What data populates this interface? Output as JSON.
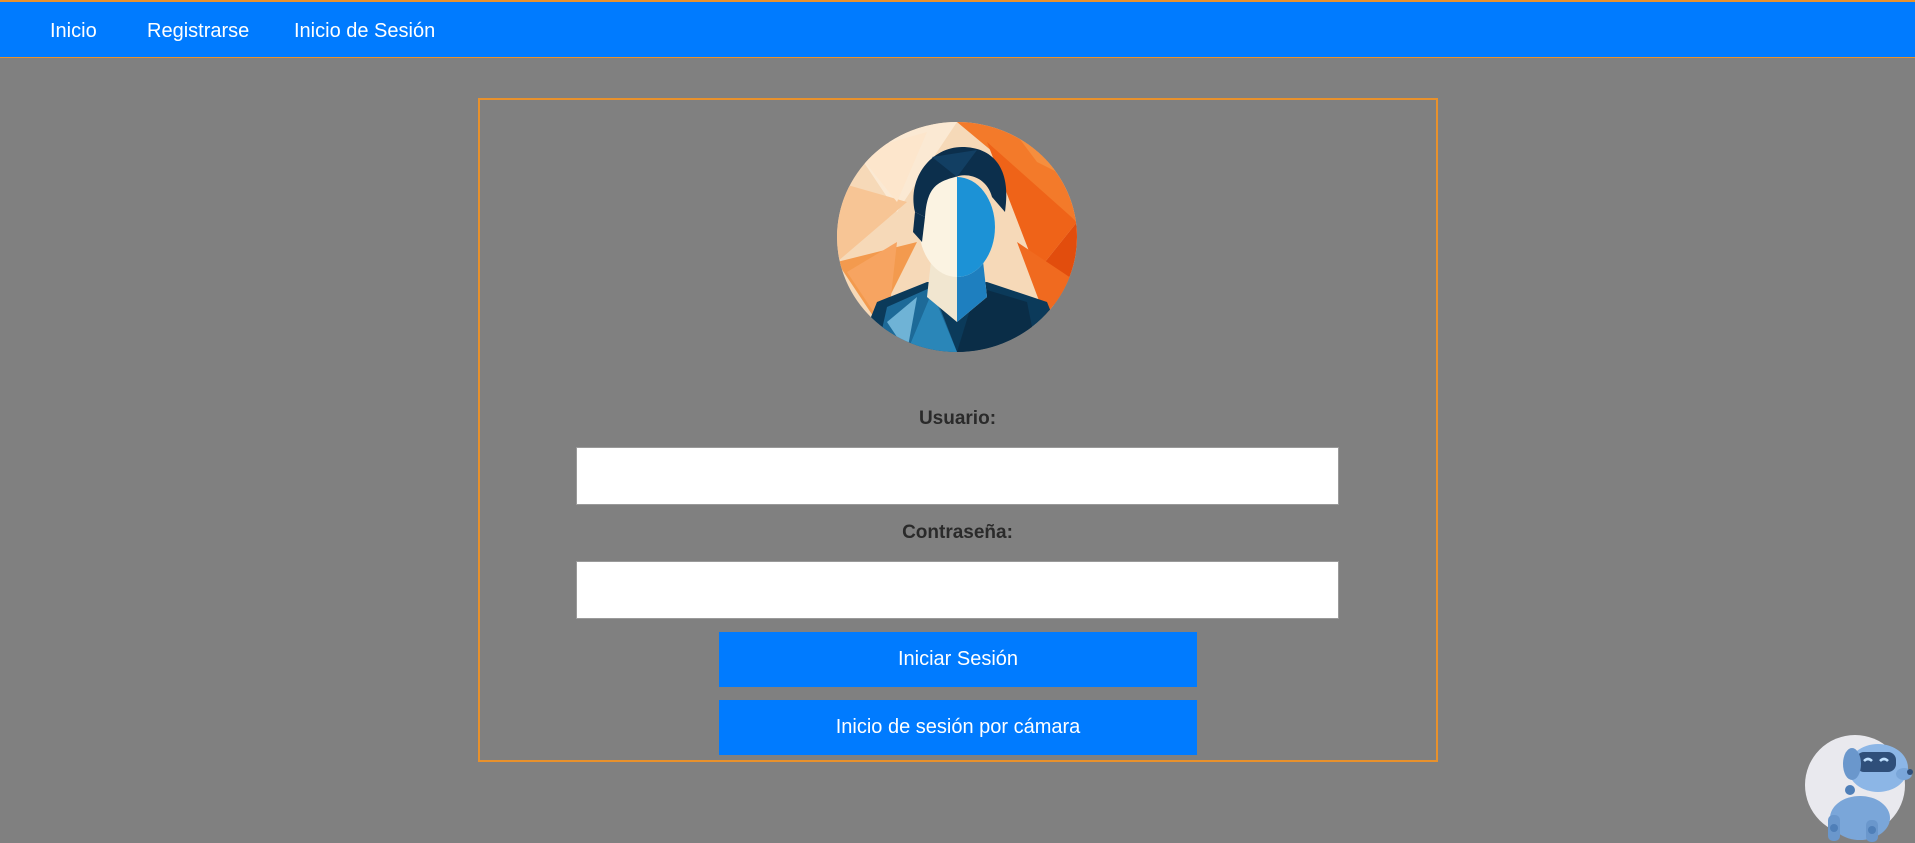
{
  "navbar": {
    "items": [
      {
        "label": "Inicio"
      },
      {
        "label": "Registrarse"
      },
      {
        "label": "Inicio de Sesión"
      }
    ]
  },
  "login": {
    "avatar_icon": "user-portrait-icon",
    "username_label": "Usuario:",
    "username_value": "",
    "password_label": "Contraseña:",
    "password_value": "",
    "login_button": "Iniciar Sesión",
    "camera_button": "Inicio de sesión por cámara"
  },
  "chat_widget": {
    "icon": "robot-dog-icon"
  },
  "colors": {
    "navbar": "#007bff",
    "accent_border": "#e8912c",
    "background": "#808080",
    "button": "#007bff"
  }
}
